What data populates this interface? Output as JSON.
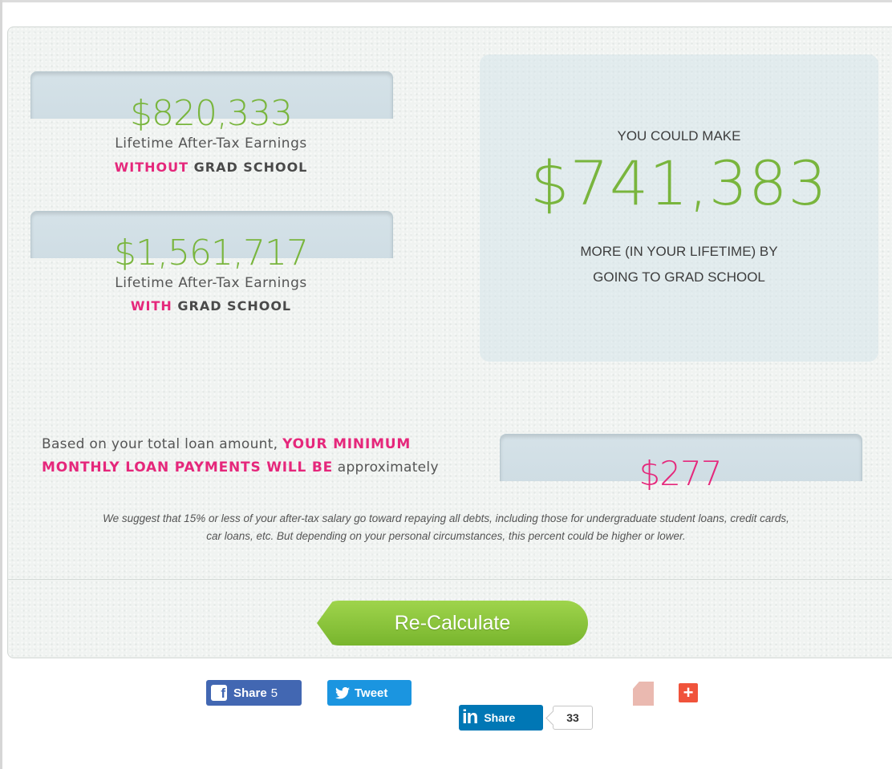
{
  "left": {
    "without": {
      "amount": "$820,333",
      "caption": "Lifetime After-Tax Earnings",
      "emphasis": "WITHOUT",
      "rest": " GRAD SCHOOL"
    },
    "with": {
      "amount": "$1,561,717",
      "caption": "Lifetime After-Tax Earnings",
      "emphasis": "WITH",
      "rest": " GRAD SCHOOL"
    }
  },
  "right": {
    "heading": "YOU COULD MAKE",
    "amount": "$741,383",
    "line1": "MORE (IN YOUR LIFETIME) BY",
    "line2": "GOING TO GRAD SCHOOL"
  },
  "loan": {
    "intro": "Based on your total loan amount, ",
    "highlight_1": "YOUR MINIMUM",
    "highlight_2": "MONTHLY LOAN PAYMENTS WILL BE",
    "suffix": " approximately",
    "amount": "$277"
  },
  "suggestion": {
    "line1": "We suggest that 15% or less of your after-tax salary go toward repaying all debts, including those for undergraduate student loans, credit cards,",
    "line2": "car loans, etc. But depending on your personal circumstances, this percent could be higher or lower."
  },
  "recalc_label": "Re-Calculate",
  "share": {
    "facebook_label": "Share",
    "facebook_count": "5",
    "twitter_label": "Tweet",
    "linkedin_label": "Share",
    "linkedin_count": "33"
  },
  "colors": {
    "green": "#79b53d",
    "pink": "#e5277b",
    "facebook": "#4267b2",
    "twitter": "#1b95e0",
    "linkedin": "#0077b5"
  }
}
